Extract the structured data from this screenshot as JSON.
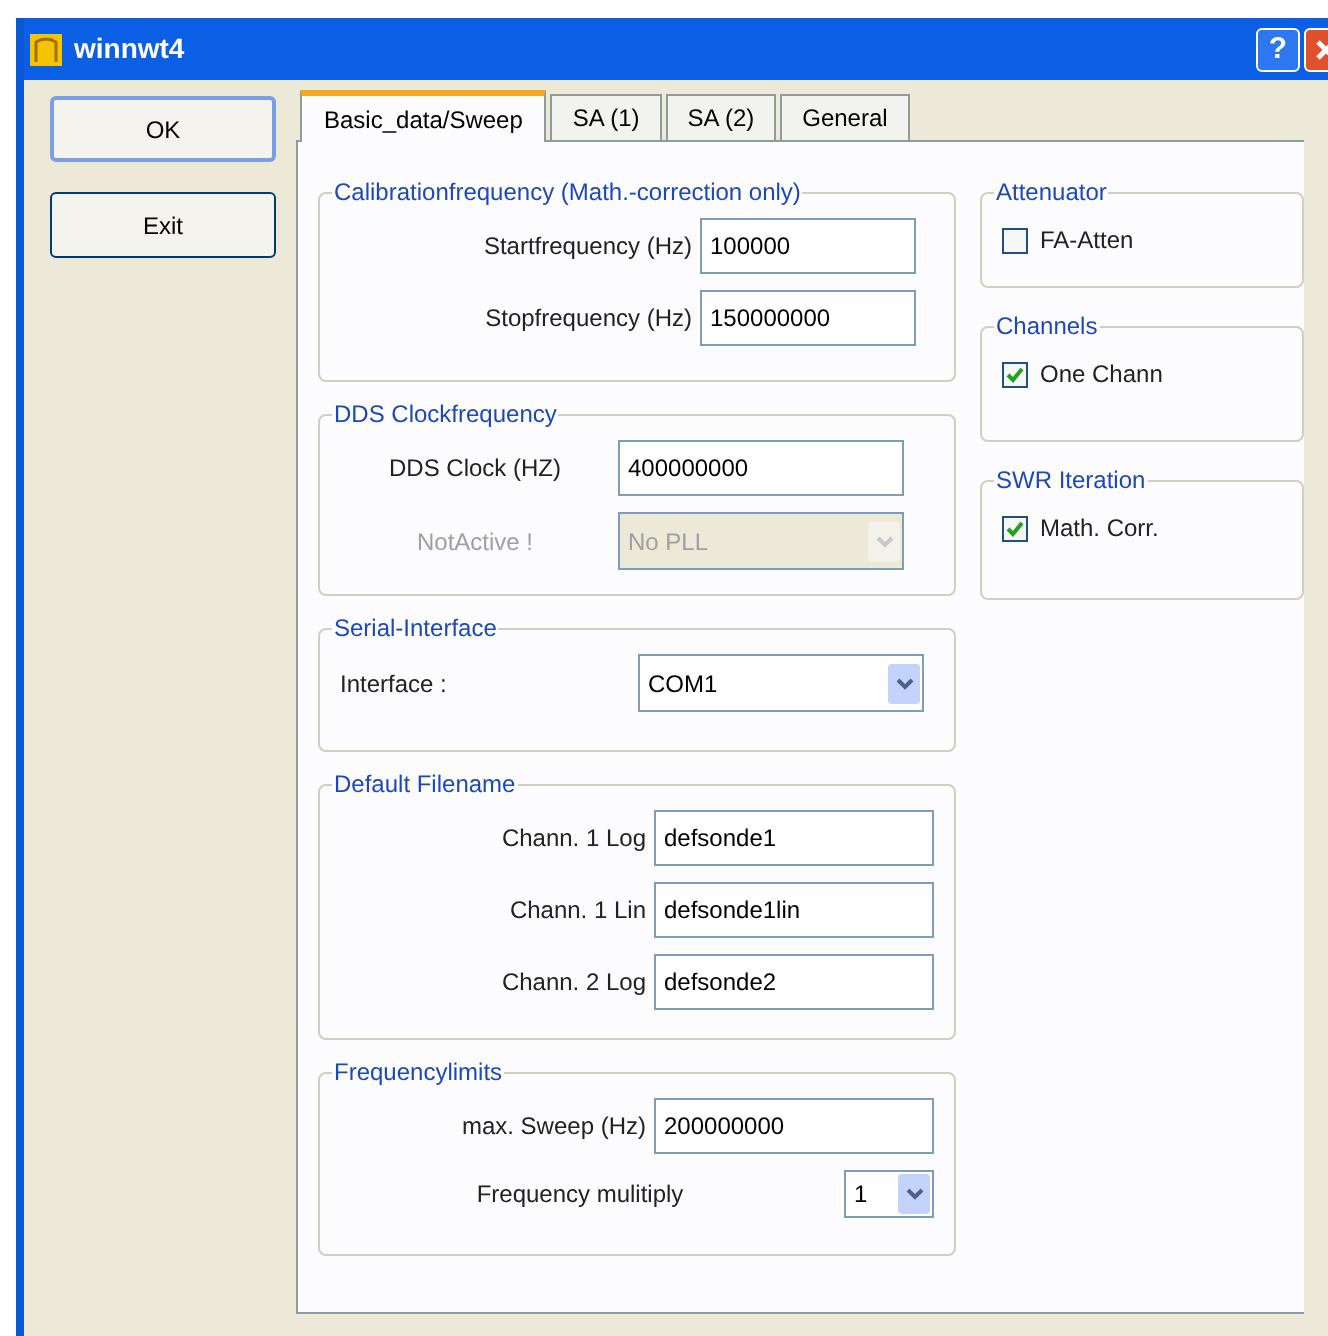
{
  "window": {
    "title": "winnwt4",
    "help_button": "?"
  },
  "buttons": [
    {
      "label": "OK",
      "default": true
    },
    {
      "label": "Exit",
      "default": false
    }
  ],
  "tabs": [
    {
      "label": "Basic_data/Sweep",
      "selected": true
    },
    {
      "label": "SA (1)",
      "selected": false
    },
    {
      "label": "SA (2)",
      "selected": false
    },
    {
      "label": "General",
      "selected": false
    }
  ],
  "groups_left": [
    {
      "title": "Calibrationfrequency (Math.-correction only)",
      "rows": [
        {
          "kind": "input",
          "label": "Startfrequency (Hz)",
          "value": "100000"
        },
        {
          "kind": "input",
          "label": "Stopfrequency (Hz)",
          "value": "150000000"
        }
      ]
    },
    {
      "title": "DDS Clockfrequency",
      "rows": [
        {
          "kind": "input",
          "label": "DDS Clock (HZ)",
          "value": "400000000"
        },
        {
          "kind": "select",
          "label": "NotActive !",
          "value": "No PLL",
          "disabled": true
        }
      ]
    },
    {
      "title": "Serial-Interface",
      "rows": [
        {
          "kind": "select",
          "label": "Interface :",
          "value": "COM1",
          "disabled": false
        }
      ]
    },
    {
      "title": "Default Filename",
      "rows": [
        {
          "kind": "input",
          "label": "Chann. 1  Log",
          "value": "defsonde1"
        },
        {
          "kind": "input",
          "label": "Chann. 1  Lin",
          "value": "defsonde1lin"
        },
        {
          "kind": "input",
          "label": "Chann. 2 Log",
          "value": "defsonde2"
        }
      ]
    },
    {
      "title": "Frequencylimits",
      "rows": [
        {
          "kind": "input",
          "label": "max. Sweep (Hz)",
          "value": "200000000"
        },
        {
          "kind": "select",
          "label": "Frequency mulitiply",
          "value": "1",
          "disabled": false
        }
      ]
    }
  ],
  "groups_right": [
    {
      "title": "Attenuator",
      "checkbox": {
        "label": "FA-Atten",
        "checked": false
      }
    },
    {
      "title": "Channels",
      "checkbox": {
        "label": "One Chann",
        "checked": true
      }
    },
    {
      "title": "SWR Iteration",
      "checkbox": {
        "label": "Math. Corr.",
        "checked": true
      }
    }
  ]
}
